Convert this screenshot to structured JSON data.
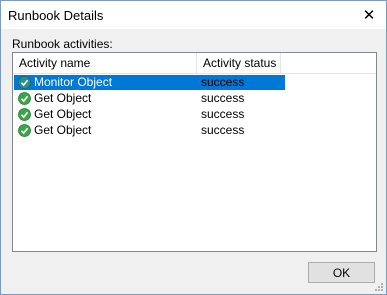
{
  "window": {
    "title": "Runbook Details",
    "close_glyph": "✕"
  },
  "activities": {
    "group_label": "Runbook activities:",
    "columns": [
      "Activity name",
      "Activity status"
    ],
    "rows": [
      {
        "name": "Monitor Object",
        "status": "success",
        "icon": "monitor-running-icon",
        "selected": true
      },
      {
        "name": "Get Object",
        "status": "success",
        "icon": "success-check-icon",
        "selected": false
      },
      {
        "name": "Get Object",
        "status": "success",
        "icon": "success-check-icon",
        "selected": false
      },
      {
        "name": "Get Object",
        "status": "success",
        "icon": "success-check-icon",
        "selected": false
      }
    ]
  },
  "footer": {
    "ok_label": "OK"
  },
  "colors": {
    "selection": "#0078d7",
    "success_green": "#3aa54a",
    "monitor_teal": "#2a8f8a"
  }
}
